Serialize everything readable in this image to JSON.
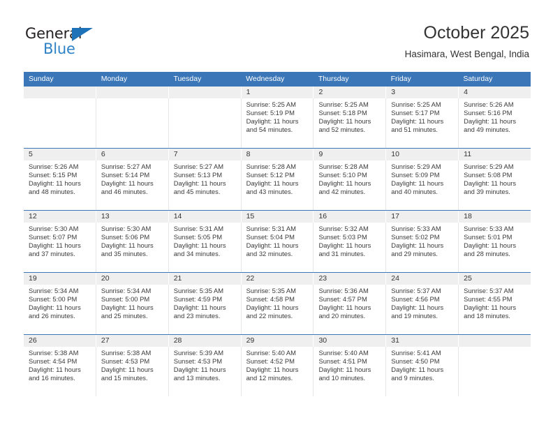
{
  "logo": {
    "word_top": "General",
    "word_bottom": "Blue",
    "triangle_color": "#1e72b8",
    "blue_color": "#2f82c6"
  },
  "header": {
    "month_title": "October 2025",
    "location": "Hasimara, West Bengal, India"
  },
  "calendar": {
    "header_color": "#3a76b8",
    "daynum_band_color": "#efeff0",
    "weekdays": [
      "Sunday",
      "Monday",
      "Tuesday",
      "Wednesday",
      "Thursday",
      "Friday",
      "Saturday"
    ],
    "weeks": [
      [
        {
          "day": "",
          "lines": []
        },
        {
          "day": "",
          "lines": []
        },
        {
          "day": "",
          "lines": []
        },
        {
          "day": "1",
          "lines": [
            "Sunrise: 5:25 AM",
            "Sunset: 5:19 PM",
            "Daylight: 11 hours",
            "and 54 minutes."
          ]
        },
        {
          "day": "2",
          "lines": [
            "Sunrise: 5:25 AM",
            "Sunset: 5:18 PM",
            "Daylight: 11 hours",
            "and 52 minutes."
          ]
        },
        {
          "day": "3",
          "lines": [
            "Sunrise: 5:25 AM",
            "Sunset: 5:17 PM",
            "Daylight: 11 hours",
            "and 51 minutes."
          ]
        },
        {
          "day": "4",
          "lines": [
            "Sunrise: 5:26 AM",
            "Sunset: 5:16 PM",
            "Daylight: 11 hours",
            "and 49 minutes."
          ]
        }
      ],
      [
        {
          "day": "5",
          "lines": [
            "Sunrise: 5:26 AM",
            "Sunset: 5:15 PM",
            "Daylight: 11 hours",
            "and 48 minutes."
          ]
        },
        {
          "day": "6",
          "lines": [
            "Sunrise: 5:27 AM",
            "Sunset: 5:14 PM",
            "Daylight: 11 hours",
            "and 46 minutes."
          ]
        },
        {
          "day": "7",
          "lines": [
            "Sunrise: 5:27 AM",
            "Sunset: 5:13 PM",
            "Daylight: 11 hours",
            "and 45 minutes."
          ]
        },
        {
          "day": "8",
          "lines": [
            "Sunrise: 5:28 AM",
            "Sunset: 5:12 PM",
            "Daylight: 11 hours",
            "and 43 minutes."
          ]
        },
        {
          "day": "9",
          "lines": [
            "Sunrise: 5:28 AM",
            "Sunset: 5:10 PM",
            "Daylight: 11 hours",
            "and 42 minutes."
          ]
        },
        {
          "day": "10",
          "lines": [
            "Sunrise: 5:29 AM",
            "Sunset: 5:09 PM",
            "Daylight: 11 hours",
            "and 40 minutes."
          ]
        },
        {
          "day": "11",
          "lines": [
            "Sunrise: 5:29 AM",
            "Sunset: 5:08 PM",
            "Daylight: 11 hours",
            "and 39 minutes."
          ]
        }
      ],
      [
        {
          "day": "12",
          "lines": [
            "Sunrise: 5:30 AM",
            "Sunset: 5:07 PM",
            "Daylight: 11 hours",
            "and 37 minutes."
          ]
        },
        {
          "day": "13",
          "lines": [
            "Sunrise: 5:30 AM",
            "Sunset: 5:06 PM",
            "Daylight: 11 hours",
            "and 35 minutes."
          ]
        },
        {
          "day": "14",
          "lines": [
            "Sunrise: 5:31 AM",
            "Sunset: 5:05 PM",
            "Daylight: 11 hours",
            "and 34 minutes."
          ]
        },
        {
          "day": "15",
          "lines": [
            "Sunrise: 5:31 AM",
            "Sunset: 5:04 PM",
            "Daylight: 11 hours",
            "and 32 minutes."
          ]
        },
        {
          "day": "16",
          "lines": [
            "Sunrise: 5:32 AM",
            "Sunset: 5:03 PM",
            "Daylight: 11 hours",
            "and 31 minutes."
          ]
        },
        {
          "day": "17",
          "lines": [
            "Sunrise: 5:33 AM",
            "Sunset: 5:02 PM",
            "Daylight: 11 hours",
            "and 29 minutes."
          ]
        },
        {
          "day": "18",
          "lines": [
            "Sunrise: 5:33 AM",
            "Sunset: 5:01 PM",
            "Daylight: 11 hours",
            "and 28 minutes."
          ]
        }
      ],
      [
        {
          "day": "19",
          "lines": [
            "Sunrise: 5:34 AM",
            "Sunset: 5:00 PM",
            "Daylight: 11 hours",
            "and 26 minutes."
          ]
        },
        {
          "day": "20",
          "lines": [
            "Sunrise: 5:34 AM",
            "Sunset: 5:00 PM",
            "Daylight: 11 hours",
            "and 25 minutes."
          ]
        },
        {
          "day": "21",
          "lines": [
            "Sunrise: 5:35 AM",
            "Sunset: 4:59 PM",
            "Daylight: 11 hours",
            "and 23 minutes."
          ]
        },
        {
          "day": "22",
          "lines": [
            "Sunrise: 5:35 AM",
            "Sunset: 4:58 PM",
            "Daylight: 11 hours",
            "and 22 minutes."
          ]
        },
        {
          "day": "23",
          "lines": [
            "Sunrise: 5:36 AM",
            "Sunset: 4:57 PM",
            "Daylight: 11 hours",
            "and 20 minutes."
          ]
        },
        {
          "day": "24",
          "lines": [
            "Sunrise: 5:37 AM",
            "Sunset: 4:56 PM",
            "Daylight: 11 hours",
            "and 19 minutes."
          ]
        },
        {
          "day": "25",
          "lines": [
            "Sunrise: 5:37 AM",
            "Sunset: 4:55 PM",
            "Daylight: 11 hours",
            "and 18 minutes."
          ]
        }
      ],
      [
        {
          "day": "26",
          "lines": [
            "Sunrise: 5:38 AM",
            "Sunset: 4:54 PM",
            "Daylight: 11 hours",
            "and 16 minutes."
          ]
        },
        {
          "day": "27",
          "lines": [
            "Sunrise: 5:38 AM",
            "Sunset: 4:53 PM",
            "Daylight: 11 hours",
            "and 15 minutes."
          ]
        },
        {
          "day": "28",
          "lines": [
            "Sunrise: 5:39 AM",
            "Sunset: 4:53 PM",
            "Daylight: 11 hours",
            "and 13 minutes."
          ]
        },
        {
          "day": "29",
          "lines": [
            "Sunrise: 5:40 AM",
            "Sunset: 4:52 PM",
            "Daylight: 11 hours",
            "and 12 minutes."
          ]
        },
        {
          "day": "30",
          "lines": [
            "Sunrise: 5:40 AM",
            "Sunset: 4:51 PM",
            "Daylight: 11 hours",
            "and 10 minutes."
          ]
        },
        {
          "day": "31",
          "lines": [
            "Sunrise: 5:41 AM",
            "Sunset: 4:50 PM",
            "Daylight: 11 hours",
            "and 9 minutes."
          ]
        },
        {
          "day": "",
          "lines": []
        }
      ]
    ]
  }
}
